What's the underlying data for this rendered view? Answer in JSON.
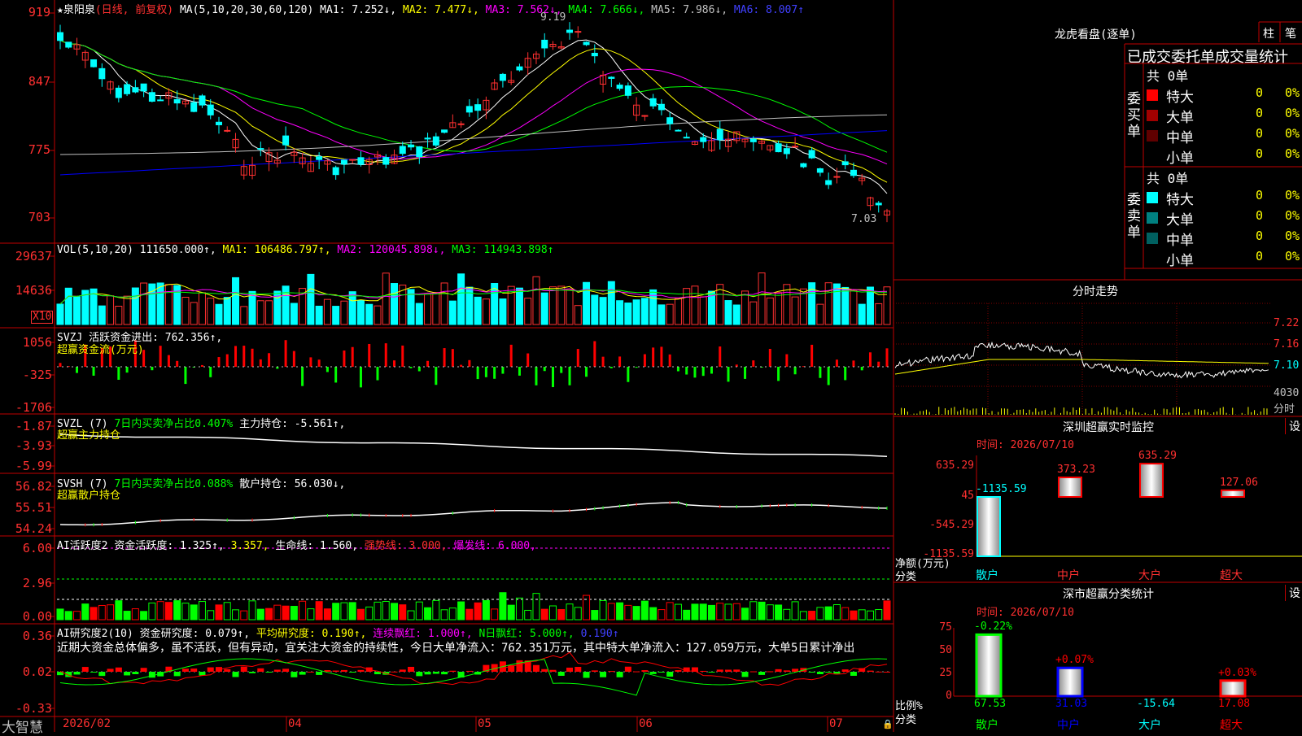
{
  "price_panel": {
    "axis": [
      "919",
      "847",
      "775",
      "703"
    ],
    "stock": "★泉阳泉",
    "period": "(日线, 前复权)",
    "ma_label": "MA(5,10,20,30,60,120)",
    "ma1": "MA1: 7.252↓,",
    "ma2": "MA2: 7.477↓,",
    "ma3": "MA3: 7.562↓,",
    "ma4": "MA4: 7.666↓,",
    "ma5": "MA5: 7.986↓,",
    "ma6": "MA6: 8.007↑",
    "high_label": "9.19",
    "low_label": "7.03",
    "colors": {
      "ma1": "#ffffff",
      "ma2": "#ffff00",
      "ma3": "#ff00ff",
      "ma4": "#00ff00",
      "ma5": "#c0c0c0",
      "ma6": "#0000ff"
    }
  },
  "vol_panel": {
    "axis": [
      "29637",
      "14636"
    ],
    "unit": "X10",
    "title": "VOL(5,10,20)",
    "value": "111650.000↑,",
    "ma1": "MA1: 106486.797↑,",
    "ma2": "MA2: 120045.898↓,",
    "ma3": "MA3: 114943.898↑"
  },
  "svzj_panel": {
    "axis": [
      "1056",
      "-325",
      "-1706"
    ],
    "title": "SVZJ  活跃资金进出: 762.356↑,",
    "sub": "超赢资金流(万元)"
  },
  "svzl_panel": {
    "axis": [
      "-1.87",
      "-3.93",
      "-5.99"
    ],
    "title_a": "SVZL (7)",
    "title_b": "7日内买卖净占比0.407%",
    "title_c": "主力持仓: -5.561↑,",
    "sub": "超赢主力持仓"
  },
  "svsh_panel": {
    "axis": [
      "56.82",
      "55.51",
      "54.24"
    ],
    "title_a": "SVSH (7)",
    "title_b": "7日内买卖净占比0.088%",
    "title_c": "散户持仓: 56.030↓,",
    "sub": "超赢散户持仓"
  },
  "ai_active_panel": {
    "axis": [
      "6.00",
      "2.96",
      "0.00"
    ],
    "t1": "AI活跃度2",
    "t2": "资金活跃度: 1.325↑,",
    "t3": "3.357,",
    "t4": "生命线: 1.560,",
    "t5": "强势线: 3.000,",
    "t6": "爆发线: 6.000,"
  },
  "ai_research_panel": {
    "axis": [
      "0.36",
      "0.02",
      "-0.33"
    ],
    "t1": "AI研究度2(10)",
    "t2": "资金研究度: 0.079↑,",
    "t3": "平均研究度: 0.190↑,",
    "t4": "连续飘红: 1.000↑,",
    "t5": "N日飘红: 5.000↑,",
    "t6": "0.190↑",
    "comment": "近期大资金总体偏多，虽不活跃，但有异动，宜关注大资金的持续性，今日大单净流入：762.351万元，其中特大单净流入：127.059万元，大单5日累计净出"
  },
  "date_axis": {
    "app": "大智慧",
    "labels": [
      "2026/02",
      "04",
      "05",
      "06",
      "07"
    ]
  },
  "right": {
    "longhu_title": "龙虎看盘(逐单)",
    "btn_zhu": "柱",
    "btn_bi": "笔",
    "stat_header": "已成交委托单成交量统计",
    "buy_label": "委买单",
    "sell_label": "委卖单",
    "buy_total": "共 0单",
    "sell_total": "共 0单",
    "buy_rows": [
      {
        "name": "特大",
        "val": "0",
        "pct": "0%",
        "color": "#ff0000"
      },
      {
        "name": "大单",
        "val": "0",
        "pct": "0%",
        "color": "#a00000"
      },
      {
        "name": "中单",
        "val": "0",
        "pct": "0%",
        "color": "#600000"
      },
      {
        "name": "小单",
        "val": "0",
        "pct": "0%",
        "color": ""
      }
    ],
    "sell_rows": [
      {
        "name": "特大",
        "val": "0",
        "pct": "0%",
        "color": "#00ffff"
      },
      {
        "name": "大单",
        "val": "0",
        "pct": "0%",
        "color": "#008080"
      },
      {
        "name": "中单",
        "val": "0",
        "pct": "0%",
        "color": "#006060"
      },
      {
        "name": "小单",
        "val": "0",
        "pct": "0%",
        "color": ""
      }
    ],
    "intraday_title": "分时走势",
    "intraday_axis": [
      "7.22",
      "7.16",
      "7.10",
      "4030",
      "分时"
    ],
    "sz_monitor_title": "深圳超赢实时监控",
    "sz_monitor_btn": "设",
    "sz_monitor_time": "时间: 2026/07/10",
    "sz_axis": [
      "635.29",
      "45",
      "-545.29",
      "-1135.59"
    ],
    "sz_ylabel": "净额(万元)",
    "sz_xlabel": "分类",
    "sz_bars": [
      {
        "label": "-1135.59",
        "value": -1135.59,
        "cat": "散户",
        "color": "#00ffff"
      },
      {
        "label": "373.23",
        "value": 373.23,
        "cat": "中户",
        "color": "#ff0000"
      },
      {
        "label": "635.29",
        "value": 635.29,
        "cat": "大户",
        "color": "#ff0000"
      },
      {
        "label": "127.06",
        "value": 127.06,
        "cat": "超大",
        "color": "#ff0000"
      }
    ],
    "sz_class_title": "深市超赢分类统计",
    "sz_class_btn": "设",
    "sz_class_time": "时间: 2026/07/10",
    "sz_class_axis": [
      "75",
      "50",
      "25",
      "0"
    ],
    "sz_class_ylabel": "比例%",
    "sz_class_xlabel": "分类",
    "sz_class_bars": [
      {
        "top": "-0.22%",
        "bottom": "67.53",
        "value": 67.53,
        "cat": "散户",
        "color": "#00ff00",
        "topcolor": "#00ff00",
        "botcolor": "#00ff00"
      },
      {
        "top": "+0.07%",
        "bottom": "31.03",
        "value": 31.03,
        "cat": "中户",
        "color": "#0000ff",
        "topcolor": "#ff0000",
        "botcolor": "#0000ff"
      },
      {
        "top": "",
        "bottom": "-15.64",
        "value": 0,
        "cat": "大户",
        "color": "#00ffff",
        "topcolor": "#ff0000",
        "botcolor": "#00ffff"
      },
      {
        "top": "+0.03%",
        "bottom": "17.08",
        "value": 17.08,
        "cat": "超大",
        "color": "#ff0000",
        "topcolor": "#ff0000",
        "botcolor": "#ff0000"
      }
    ]
  }
}
